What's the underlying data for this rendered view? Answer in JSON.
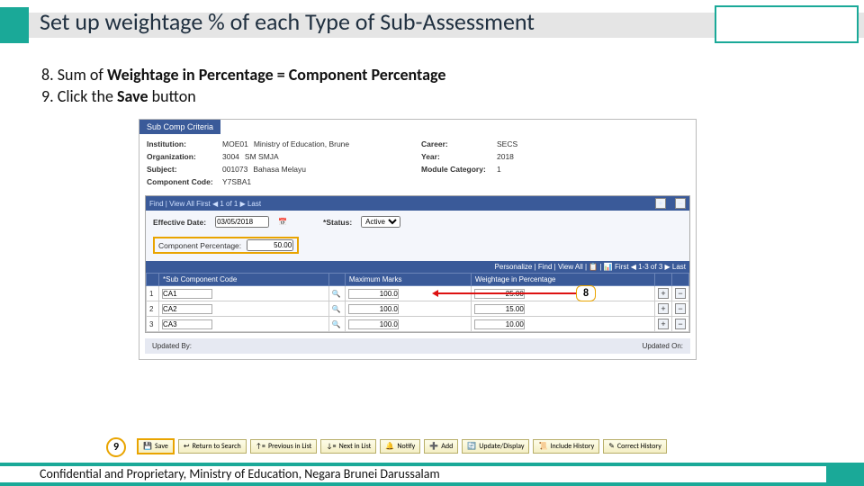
{
  "title": "Set up weightage % of each Type of Sub-Assessment",
  "instructions": {
    "line8_prefix": "8. Sum of ",
    "line8_bold": "Weightage in Percentage = Component Percentage",
    "line9_prefix": "9. Click the ",
    "line9_bold": "Save",
    "line9_suffix": " button"
  },
  "callouts": {
    "c8": "8",
    "c9": "9"
  },
  "tab": "Sub Comp Criteria",
  "fields": {
    "institution_lbl": "Institution:",
    "institution_val": "MOE01",
    "institution_desc": "Ministry of Education, Brune",
    "career_lbl": "Career:",
    "career_val": "SECS",
    "organization_lbl": "Organization:",
    "organization_val": "3004",
    "organization_desc": "SM SMJA",
    "year_lbl": "Year:",
    "year_val": "2018",
    "subject_lbl": "Subject:",
    "subject_val": "001073",
    "subject_desc": "Bahasa Melayu",
    "modcat_lbl": "Module Category:",
    "modcat_val": "1",
    "compcode_lbl": "Component Code:",
    "compcode_val": "Y7SBA1"
  },
  "section": {
    "nav": "Find | View All    First ◀ 1 of 1 ▶ Last",
    "eff_lbl": "Effective Date:",
    "eff_val": "03/05/2018",
    "status_lbl": "*Status:",
    "status_val": "Active",
    "comp_lbl": "Component Percentage:",
    "comp_val": "50.00",
    "grid_nav": "Personalize | Find | View All | 📋 | 📊    First ◀ 1-3 of 3 ▶ Last",
    "cols": {
      "idx": "",
      "subcode": "*Sub Component Code",
      "max": "Maximum Marks",
      "weight": "Weightage in Percentage"
    },
    "rows": [
      {
        "n": "1",
        "code": "CA1",
        "max": "100.0",
        "weight": "25.00"
      },
      {
        "n": "2",
        "code": "CA2",
        "max": "100.0",
        "weight": "15.00"
      },
      {
        "n": "3",
        "code": "CA3",
        "max": "100.0",
        "weight": "10.00"
      }
    ],
    "updated_by": "Updated By:",
    "updated_on": "Updated On:"
  },
  "buttons": {
    "save": "Save",
    "return": "Return to Search",
    "prev": "Previous in List",
    "next": "Next in List",
    "notify": "Notify",
    "add": "Add",
    "upd": "Update/Display",
    "inch": "Include History",
    "corh": "Correct History"
  },
  "footer": "Confidential and Proprietary, Ministry of Education, Negara Brunei Darussalam"
}
